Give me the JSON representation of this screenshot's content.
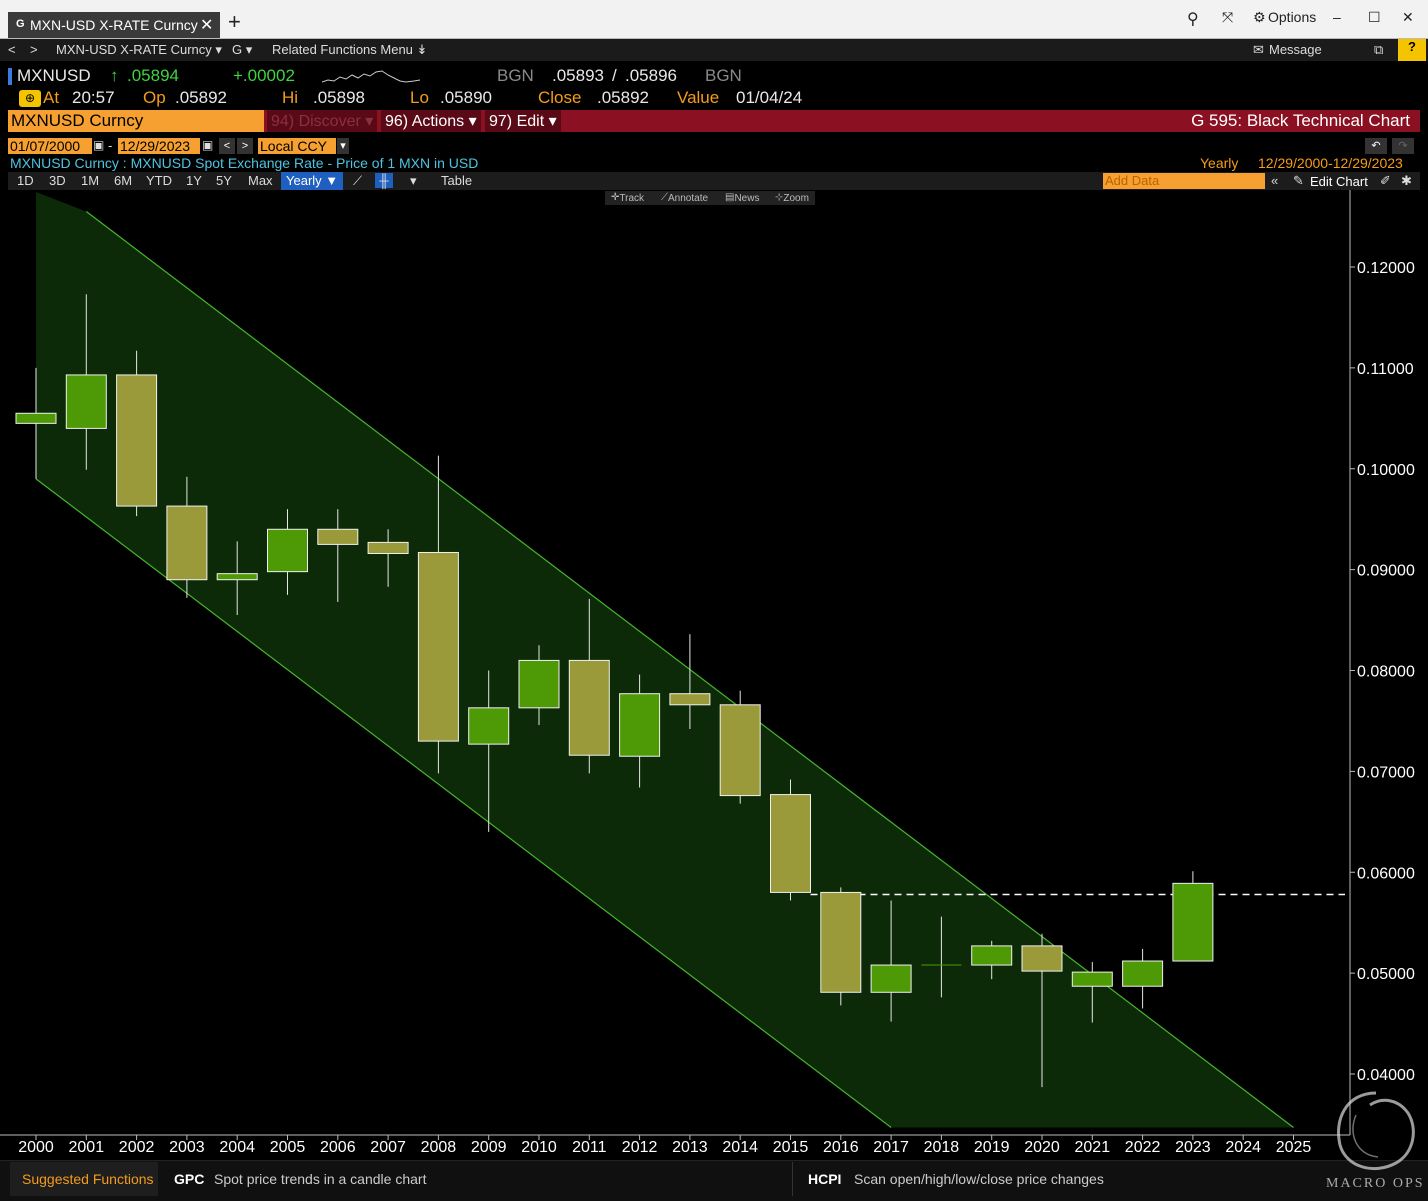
{
  "window": {
    "tab_badge": "G",
    "tab_title": "MXN-USD X-RATE Curncy",
    "options_label": "Options",
    "close_glyph": "✕",
    "new_tab_glyph": "+"
  },
  "nav": {
    "back": "<",
    "forward": ">",
    "security": "MXN-USD X-RATE Curncy ▾",
    "function": "G ▾",
    "related": "Related Functions Menu ↡",
    "message": "Message"
  },
  "quote": {
    "ticker": "MXNUSD",
    "arrow": "↑",
    "last": ".05894",
    "change": "+.00002",
    "source1": "BGN",
    "bid": ".05893",
    "ask": ".05896",
    "source2": "BGN",
    "at_label": "At",
    "time": "20:57",
    "open_label": "Op",
    "open": ".05892",
    "high_label": "Hi",
    "high": ".05898",
    "low_label": "Lo",
    "low": ".05890",
    "close_label": "Close",
    "close": ".05892",
    "value_label": "Value",
    "value_date": "01/04/24"
  },
  "toolbar": {
    "security_name": "MXNUSD Curncy",
    "discover": "94) Discover ▾",
    "actions": "96) Actions ▾",
    "edit": "97) Edit ▾",
    "function_title": "G 595: Black Technical Chart",
    "start_date": "01/07/2000",
    "end_date": "12/29/2023",
    "currency": "Local CCY",
    "subtitle": "MXNUSD Curncy : MXNUSD Spot Exchange Rate - Price of 1 MXN in USD",
    "period": "Yearly",
    "range": "12/29/2000-12/29/2023",
    "ranges": [
      "1D",
      "3D",
      "1M",
      "6M",
      "YTD",
      "1Y",
      "5Y",
      "Max"
    ],
    "yearly": "Yearly ▼",
    "table": "Table",
    "add_data": "Add Data",
    "edit_chart": "Edit Chart",
    "chart_menu": [
      "Track",
      "Annotate",
      "News",
      "Zoom"
    ]
  },
  "chart_data": {
    "type": "candlestick",
    "title": "",
    "ylim": [
      0.0345,
      0.1245
    ],
    "y_ticks": [
      "0.04000",
      "0.05000",
      "0.06000",
      "0.07000",
      "0.08000",
      "0.09000",
      "0.10000",
      "0.11000",
      "0.12000"
    ],
    "x_ticks": [
      "2000",
      "2001",
      "2002",
      "2003",
      "2004",
      "2005",
      "2006",
      "2007",
      "2008",
      "2009",
      "2010",
      "2011",
      "2012",
      "2013",
      "2014",
      "2015",
      "2016",
      "2017",
      "2018",
      "2019",
      "2020",
      "2021",
      "2022",
      "2023",
      "2024",
      "2025"
    ],
    "candles": [
      {
        "year": "2000",
        "open": 0.1045,
        "high": 0.11,
        "low": 0.099,
        "close": 0.1055
      },
      {
        "year": "2001",
        "open": 0.104,
        "high": 0.1173,
        "low": 0.0999,
        "close": 0.1093
      },
      {
        "year": "2002",
        "open": 0.1093,
        "high": 0.1117,
        "low": 0.0953,
        "close": 0.0963
      },
      {
        "year": "2003",
        "open": 0.0963,
        "high": 0.0992,
        "low": 0.0872,
        "close": 0.089
      },
      {
        "year": "2004",
        "open": 0.089,
        "high": 0.0928,
        "low": 0.0855,
        "close": 0.0896
      },
      {
        "year": "2005",
        "open": 0.0898,
        "high": 0.096,
        "low": 0.0875,
        "close": 0.094
      },
      {
        "year": "2006",
        "open": 0.094,
        "high": 0.096,
        "low": 0.0868,
        "close": 0.0925
      },
      {
        "year": "2007",
        "open": 0.0927,
        "high": 0.094,
        "low": 0.0883,
        "close": 0.0916
      },
      {
        "year": "2008",
        "open": 0.0917,
        "high": 0.1013,
        "low": 0.0698,
        "close": 0.073
      },
      {
        "year": "2009",
        "open": 0.0727,
        "high": 0.08,
        "low": 0.064,
        "close": 0.0763
      },
      {
        "year": "2010",
        "open": 0.0763,
        "high": 0.0825,
        "low": 0.0746,
        "close": 0.081
      },
      {
        "year": "2011",
        "open": 0.081,
        "high": 0.0871,
        "low": 0.0698,
        "close": 0.0716
      },
      {
        "year": "2012",
        "open": 0.0715,
        "high": 0.0796,
        "low": 0.0684,
        "close": 0.0777
      },
      {
        "year": "2013",
        "open": 0.0777,
        "high": 0.0836,
        "low": 0.0742,
        "close": 0.0766
      },
      {
        "year": "2014",
        "open": 0.0766,
        "high": 0.078,
        "low": 0.0668,
        "close": 0.0676
      },
      {
        "year": "2015",
        "open": 0.0677,
        "high": 0.0692,
        "low": 0.0572,
        "close": 0.058
      },
      {
        "year": "2016",
        "open": 0.058,
        "high": 0.0585,
        "low": 0.0468,
        "close": 0.0481
      },
      {
        "year": "2017",
        "open": 0.0481,
        "high": 0.0572,
        "low": 0.0452,
        "close": 0.0508
      },
      {
        "year": "2018",
        "open": 0.0508,
        "high": 0.0556,
        "low": 0.0476,
        "close": 0.0508
      },
      {
        "year": "2019",
        "open": 0.0508,
        "high": 0.0532,
        "low": 0.0494,
        "close": 0.0527
      },
      {
        "year": "2020",
        "open": 0.0527,
        "high": 0.0539,
        "low": 0.0387,
        "close": 0.0502
      },
      {
        "year": "2021",
        "open": 0.0487,
        "high": 0.0511,
        "low": 0.0451,
        "close": 0.0501
      },
      {
        "year": "2022",
        "open": 0.0487,
        "high": 0.0524,
        "low": 0.0465,
        "close": 0.0512
      },
      {
        "year": "2023",
        "open": 0.0512,
        "high": 0.0601,
        "low": 0.0512,
        "close": 0.0589
      }
    ],
    "reference_line": 0.0578,
    "channel": {
      "upper": [
        [
          "2001",
          0.1255
        ],
        [
          "2025",
          0.0347
        ]
      ],
      "lower": [
        [
          "2000",
          0.099
        ],
        [
          "2017",
          0.0347
        ]
      ]
    },
    "colors": {
      "up": "#4e9a06",
      "down": "#9a9a3a",
      "channel_fill": "#0c2a08",
      "channel_line": "#47b52e",
      "reference": "#ffffff"
    }
  },
  "footer": {
    "suggested": "Suggested Functions",
    "f1_key": "GPC",
    "f1_desc": "Spot price trends in a candle chart",
    "f2_key": "HCPI",
    "f2_desc": "Scan open/high/low/close price changes",
    "logo_text": "MACRO OPS"
  }
}
